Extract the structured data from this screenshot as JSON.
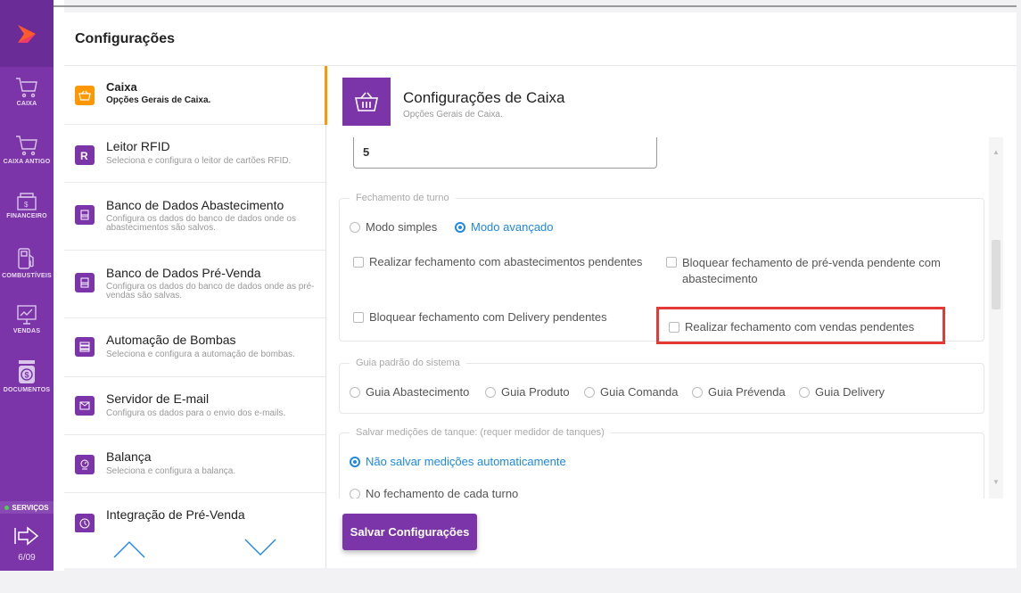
{
  "sidebar": {
    "items": [
      {
        "label": "CAIXA",
        "icon": "cart-icon"
      },
      {
        "label": "CAIXA ANTIGO",
        "icon": "cart-icon"
      },
      {
        "label": "FINANCEIRO",
        "icon": "cash-register-icon"
      },
      {
        "label": "COMBUSTÍVEIS",
        "icon": "fuel-pump-icon"
      },
      {
        "label": "VENDAS",
        "icon": "monitor-chart-icon"
      },
      {
        "label": "DOCUMENTOS",
        "icon": "money-bag-icon"
      }
    ],
    "services": "SERVIÇOS",
    "date": "6/09",
    "accent": "#7b35a9"
  },
  "header": {
    "title": "Configurações"
  },
  "config_list": [
    {
      "title": "Caixa",
      "desc": "Opções Gerais de Caixa.",
      "icon": "basket-icon",
      "active": true
    },
    {
      "title": "Leitor RFID",
      "desc": "Seleciona e configura o leitor de cartões RFID.",
      "icon": "rfid-icon"
    },
    {
      "title": "Banco de Dados Abastecimento",
      "desc": "Configura os dados do banco de dados onde os abastecimentos são salvos.",
      "icon": "database-icon"
    },
    {
      "title": "Banco de Dados Pré-Venda",
      "desc": "Configura os dados do banco de dados onde as pré-vendas são salvas.",
      "icon": "database-icon"
    },
    {
      "title": "Automação de Bombas",
      "desc": "Seleciona e configura a automação de bombas.",
      "icon": "server-icon"
    },
    {
      "title": "Servidor de E-mail",
      "desc": "Configura os dados para o envio dos e-mails.",
      "icon": "mail-icon"
    },
    {
      "title": "Balança",
      "desc": "Seleciona e configura a balança.",
      "icon": "scale-icon"
    },
    {
      "title": "Integração de Pré-Venda",
      "desc": "",
      "icon": "clock-icon"
    }
  ],
  "content": {
    "title": "Configurações de Caixa",
    "subtitle": "Opções Gerais de Caixa.",
    "field_value": "5",
    "fechamento": {
      "legend": "Fechamento de turno",
      "mode_simple": "Modo simples",
      "mode_advanced": "Modo avançado",
      "cb1": "Realizar fechamento com abastecimentos pendentes",
      "cb2": "Bloquear fechamento de pré-venda pendente com abastecimento",
      "cb3": "Bloquear fechamento com Delivery pendentes",
      "cb4": "Realizar fechamento com vendas pendentes"
    },
    "guia": {
      "legend": "Guia padrão do sistema",
      "options": [
        "Guia Abastecimento",
        "Guia Produto",
        "Guia Comanda",
        "Guia Prévenda",
        "Guia Delivery"
      ]
    },
    "tanque": {
      "legend": "Salvar medições de tanque: (requer medidor de tanques)",
      "opt1": "Não salvar medições automaticamente",
      "opt2": "No fechamento de cada turno"
    },
    "save_label": "Salvar Configurações"
  },
  "colors": {
    "accent": "#7b35a9",
    "active": "#ff9800",
    "selected": "#1e88e5",
    "highlight": "#e53935"
  }
}
